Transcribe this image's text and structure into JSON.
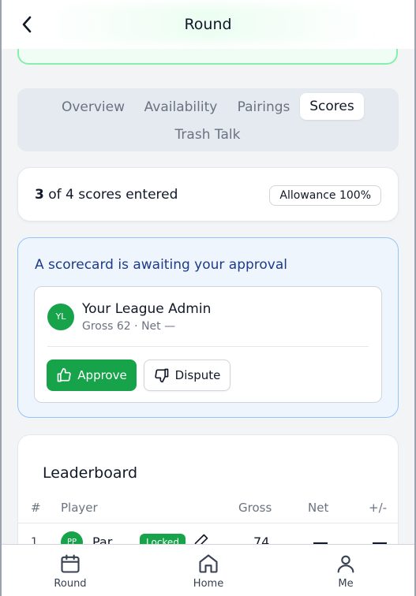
{
  "header": {
    "title": "Round",
    "back_icon": "chevron-left-icon"
  },
  "tabs": [
    {
      "label": "Overview",
      "active": false
    },
    {
      "label": "Availability",
      "active": false
    },
    {
      "label": "Pairings",
      "active": false
    },
    {
      "label": "Scores",
      "active": true
    },
    {
      "label": "Trash Talk",
      "active": false
    }
  ],
  "scores_summary": {
    "entered": "3",
    "rest": "of 4 scores entered",
    "allowance": "Allowance 100%"
  },
  "approval": {
    "title": "A scorecard is awaiting your approval",
    "avatar_initials": "YL",
    "player_name": "Your League Admin",
    "player_detail": "Gross 62 · Net —",
    "approve_label": "Approve",
    "dispute_label": "Dispute",
    "approve_icon": "thumbs-up-icon",
    "dispute_icon": "thumbs-down-icon"
  },
  "leaderboard": {
    "title": "Leaderboard",
    "columns": [
      "#",
      "Player",
      "Gross",
      "Net",
      "+/-"
    ],
    "rows": [
      {
        "rank": "1",
        "initials": "PP",
        "name": "Par",
        "badge": "Locked",
        "gross": "74"
      }
    ]
  },
  "bottom_nav": [
    {
      "label": "Round",
      "icon": "calendar-icon"
    },
    {
      "label": "Home",
      "icon": "home-icon"
    },
    {
      "label": "Me",
      "icon": "user-icon"
    }
  ],
  "colors": {
    "accent": "#16a34a",
    "approval_bg": "#eef5fd",
    "approval_title": "#1e3a8a"
  }
}
